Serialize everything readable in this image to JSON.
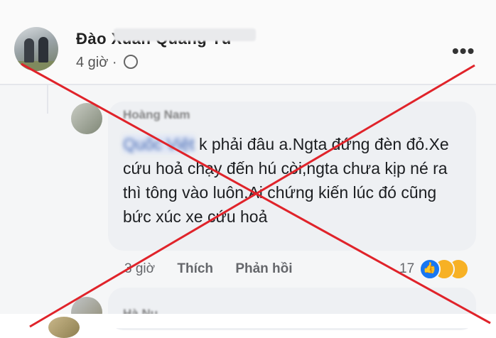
{
  "post": {
    "author_name": "Đào Xuân Quang Tú",
    "time": "4 giờ · ",
    "more_label": "•••"
  },
  "comment": {
    "author_name": "Hoàng Nam",
    "mention": "Quốc Việt",
    "text": " k phải đâu a.Ngta đứng đèn đỏ.Xe cứu hoả chạy đến hú còi,ngta chưa kịp né ra thì tông vào luôn.Ai chứng kiến lúc đó cũng bức xúc xe cứu hoả",
    "time": "3 giờ",
    "like_label": "Thích",
    "reply_label": "Phản hồi",
    "reaction_count": "17",
    "reactions": [
      "like-reaction-icon",
      "sad-reaction-icon",
      "wow-reaction-icon"
    ]
  },
  "reply": {
    "author_name": "Hà Nu"
  },
  "colors": {
    "cross_red": "#e0232a",
    "link_blue": "#4267b2",
    "like_blue": "#1877f2"
  }
}
